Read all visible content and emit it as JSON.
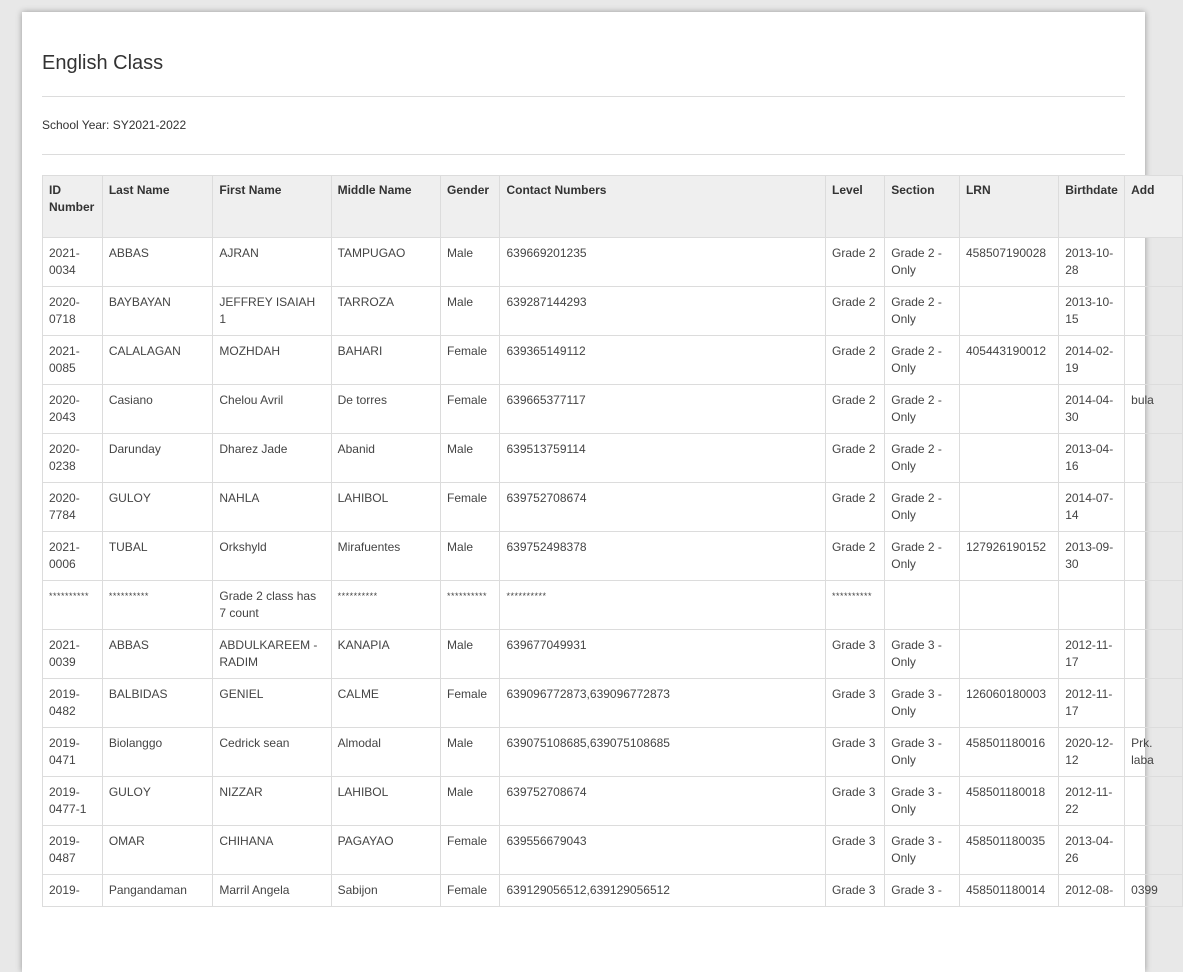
{
  "page": {
    "title": "English Class",
    "school_year_label": "School Year:",
    "school_year": "SY2021-2022"
  },
  "table": {
    "headers": [
      "ID Number",
      "Last Name",
      "First Name",
      "Middle Name",
      "Gender",
      "Contact Numbers",
      "Level",
      "Section",
      "LRN",
      "Birthdate",
      "Add"
    ],
    "rows": [
      {
        "id": "2021-0034",
        "last": "ABBAS",
        "first": "AJRAN",
        "middle": "TAMPUGAO",
        "gender": "Male",
        "contact": "639669201235",
        "level": "Grade 2",
        "section": "Grade 2 - Only",
        "lrn": "458507190028",
        "birthdate": "2013-10-28",
        "address": ""
      },
      {
        "id": "2020-0718",
        "last": "BAYBAYAN",
        "first": "JEFFREY ISAIAH 1",
        "middle": "TARROZA",
        "gender": "Male",
        "contact": "639287144293",
        "level": "Grade 2",
        "section": "Grade 2 - Only",
        "lrn": "",
        "birthdate": "2013-10-15",
        "address": ""
      },
      {
        "id": "2021-0085",
        "last": "CALALAGAN",
        "first": "MOZHDAH",
        "middle": "BAHARI",
        "gender": "Female",
        "contact": "639365149112",
        "level": "Grade 2",
        "section": "Grade 2 - Only",
        "lrn": "405443190012",
        "birthdate": "2014-02-19",
        "address": ""
      },
      {
        "id": "2020-2043",
        "last": "Casiano",
        "first": "Chelou Avril",
        "middle": "De torres",
        "gender": "Female",
        "contact": "639665377117",
        "level": "Grade 2",
        "section": "Grade 2 - Only",
        "lrn": "",
        "birthdate": "2014-04-30",
        "address": "bula"
      },
      {
        "id": "2020-0238",
        "last": "Darunday",
        "first": "Dharez Jade",
        "middle": "Abanid",
        "gender": "Male",
        "contact": "639513759114",
        "level": "Grade 2",
        "section": "Grade 2 - Only",
        "lrn": "",
        "birthdate": "2013-04-16",
        "address": ""
      },
      {
        "id": "2020-7784",
        "last": "GULOY",
        "first": "NAHLA",
        "middle": "LAHIBOL",
        "gender": "Female",
        "contact": "639752708674",
        "level": "Grade 2",
        "section": "Grade 2 - Only",
        "lrn": "",
        "birthdate": "2014-07-14",
        "address": ""
      },
      {
        "id": "2021-0006",
        "last": "TUBAL",
        "first": "Orkshyld",
        "middle": "Mirafuentes",
        "gender": "Male",
        "contact": "639752498378",
        "level": "Grade 2",
        "section": "Grade 2 - Only",
        "lrn": "127926190152",
        "birthdate": "2013-09-30",
        "address": ""
      },
      {
        "separator": true,
        "id": "**********",
        "last": "**********",
        "first": "Grade 2 class has 7 count",
        "middle": "**********",
        "gender": "**********",
        "contact": "**********",
        "level": "**********",
        "section": "",
        "lrn": "",
        "birthdate": "",
        "address": ""
      },
      {
        "id": "2021-0039",
        "last": "ABBAS",
        "first": "ABDULKAREEM - RADIM",
        "middle": "KANAPIA",
        "gender": "Male",
        "contact": "639677049931",
        "level": "Grade 3",
        "section": "Grade 3 - Only",
        "lrn": "",
        "birthdate": "2012-11-17",
        "address": ""
      },
      {
        "id": "2019-0482",
        "last": "BALBIDAS",
        "first": "GENIEL",
        "middle": "CALME",
        "gender": "Female",
        "contact": "639096772873,639096772873",
        "level": "Grade 3",
        "section": "Grade 3 - Only",
        "lrn": "126060180003",
        "birthdate": "2012-11-17",
        "address": ""
      },
      {
        "id": "2019-0471",
        "last": "Biolanggo",
        "first": "Cedrick sean",
        "middle": "Almodal",
        "gender": "Male",
        "contact": "639075108685,639075108685",
        "level": "Grade 3",
        "section": "Grade 3 - Only",
        "lrn": "458501180016",
        "birthdate": "2020-12-12",
        "address": "Prk. laba"
      },
      {
        "id": "2019-0477-1",
        "last": "GULOY",
        "first": "NIZZAR",
        "middle": "LAHIBOL",
        "gender": "Male",
        "contact": "639752708674",
        "level": "Grade 3",
        "section": "Grade 3 - Only",
        "lrn": "458501180018",
        "birthdate": "2012-11-22",
        "address": ""
      },
      {
        "id": "2019-0487",
        "last": "OMAR",
        "first": "CHIHANA",
        "middle": "PAGAYAO",
        "gender": "Female",
        "contact": "639556679043",
        "level": "Grade 3",
        "section": "Grade 3 - Only",
        "lrn": "458501180035",
        "birthdate": "2013-04-26",
        "address": ""
      },
      {
        "id": "2019-",
        "last": "Pangandaman",
        "first": "Marril Angela",
        "middle": "Sabijon",
        "gender": "Female",
        "contact": "639129056512,639129056512",
        "level": "Grade 3",
        "section": "Grade 3 -",
        "lrn": "458501180014",
        "birthdate": "2012-08-",
        "address": "0399"
      }
    ]
  }
}
